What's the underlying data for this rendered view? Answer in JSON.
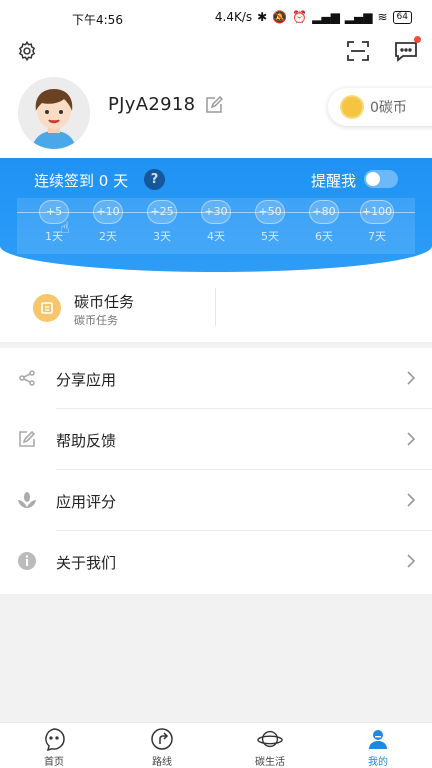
{
  "statusbar": {
    "time": "下午4:56",
    "network_speed": "4.4K/s",
    "battery": "64"
  },
  "profile": {
    "username": "PJyA2918",
    "coins": "0碳币"
  },
  "signin": {
    "title": "连续签到 0 天",
    "help": "?",
    "remind_label": "提醒我",
    "remind_on": false,
    "days": [
      {
        "reward": "+5",
        "label": "1天"
      },
      {
        "reward": "+10",
        "label": "2天"
      },
      {
        "reward": "+25",
        "label": "3天"
      },
      {
        "reward": "+30",
        "label": "4天"
      },
      {
        "reward": "+50",
        "label": "5天"
      },
      {
        "reward": "+80",
        "label": "6天"
      },
      {
        "reward": "+100",
        "label": "7天"
      }
    ]
  },
  "task": {
    "title": "碳币任务",
    "subtitle": "碳币任务"
  },
  "menu": [
    {
      "label": "分享应用",
      "icon": "share-icon"
    },
    {
      "label": "帮助反馈",
      "icon": "feedback-icon"
    },
    {
      "label": "应用评分",
      "icon": "rating-icon"
    },
    {
      "label": "关于我们",
      "icon": "info-icon"
    }
  ],
  "tabs": [
    {
      "label": "首页",
      "icon": "home-icon",
      "active": false
    },
    {
      "label": "路线",
      "icon": "route-icon",
      "active": false
    },
    {
      "label": "碳生活",
      "icon": "planet-icon",
      "active": false
    },
    {
      "label": "我的",
      "icon": "profile-icon",
      "active": true
    }
  ],
  "colors": {
    "primary": "#1e88e5",
    "band": "#1f92f5",
    "coin": "#f5c542"
  }
}
